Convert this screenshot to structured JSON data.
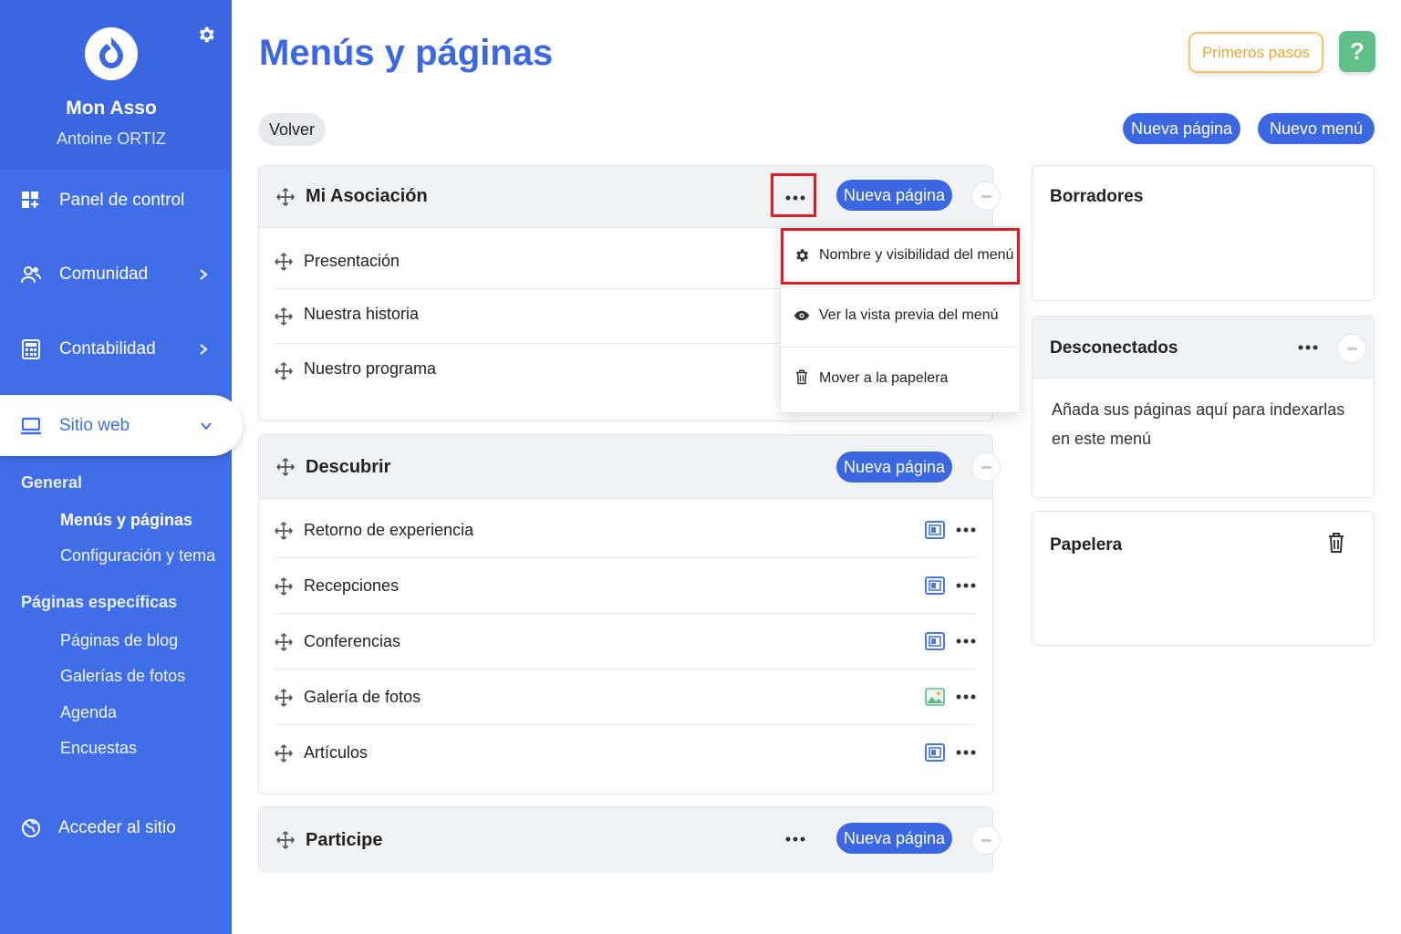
{
  "sidebar": {
    "brand_name": "Mon Asso",
    "brand_user": "Antoine ORTIZ",
    "items": [
      {
        "label": "Panel de control",
        "icon": "dashboard-icon"
      },
      {
        "label": "Comunidad",
        "icon": "users-icon"
      },
      {
        "label": "Contabilidad",
        "icon": "calculator-icon"
      },
      {
        "label": "Sitio web",
        "icon": "monitor-icon"
      }
    ],
    "general_heading": "General",
    "general_items": [
      "Menús y páginas",
      "Configuración y tema"
    ],
    "specific_heading": "Páginas específicas",
    "specific_items": [
      "Páginas de blog",
      "Galerías de fotos",
      "Agenda",
      "Encuestas"
    ],
    "access_site": "Acceder al sitio"
  },
  "header": {
    "title": "Menús y páginas",
    "first_steps": "Primeros pasos",
    "help": "?",
    "back": "Volver",
    "new_page": "Nueva página",
    "new_menu": "Nuevo menú"
  },
  "menus": [
    {
      "title": "Mi Asociación",
      "new_page": "Nueva página",
      "pages": [
        "Presentación",
        "Nuestra historia",
        "Nuestro programa"
      ]
    },
    {
      "title": "Descubrir",
      "new_page": "Nueva página",
      "pages": [
        "Retorno de experiencia",
        "Recepciones",
        "Conferencias",
        "Galería de fotos",
        "Artículos"
      ]
    },
    {
      "title": "Participe",
      "new_page": "Nueva página",
      "pages": []
    }
  ],
  "dropdown": {
    "items": [
      "Nombre y visibilidad del menú",
      "Ver la vista previa del menú",
      "Mover a la papelera"
    ]
  },
  "right": {
    "drafts_title": "Borradores",
    "disconnected_title": "Desconectados",
    "disconnected_text": "Añada sus páginas aquí para indexarlas en este menú",
    "trash_title": "Papelera"
  },
  "colors": {
    "primary": "#3c67e3",
    "sidebar": "#3f6ee8",
    "highlight": "#e21b22",
    "first_steps": "#e9a52d",
    "help": "#5fc08a"
  }
}
